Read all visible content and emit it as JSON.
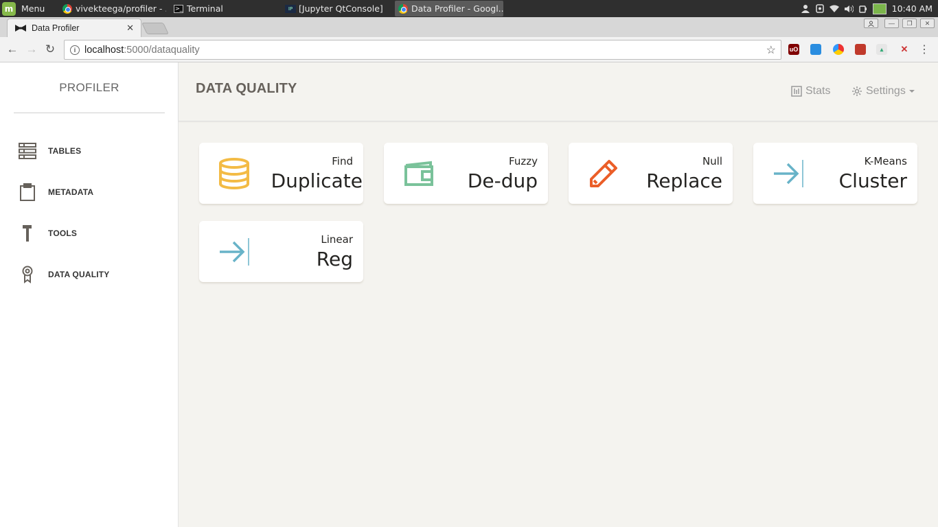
{
  "taskbar": {
    "menu_label": "Menu",
    "tasks": [
      {
        "label": "vivekteega/profiler - ...",
        "icon": "chrome-icon"
      },
      {
        "label": "Terminal",
        "icon": "terminal-icon"
      },
      {
        "label": "[Jupyter QtConsole]",
        "icon": "ipython-icon"
      },
      {
        "label": "Data Profiler - Googl...",
        "icon": "chrome-icon"
      }
    ],
    "clock": "10:40 AM"
  },
  "browser": {
    "tab_title": "Data Profiler",
    "url_host": "localhost",
    "url_path": ":5000/dataquality"
  },
  "sidebar": {
    "brand": "PROFILER",
    "items": [
      {
        "label": "TABLES",
        "icon": "table-list-icon"
      },
      {
        "label": "METADATA",
        "icon": "clipboard-icon"
      },
      {
        "label": "TOOLS",
        "icon": "hammer-icon"
      },
      {
        "label": "DATA QUALITY",
        "icon": "award-ribbon-icon"
      }
    ]
  },
  "header": {
    "title": "DATA QUALITY",
    "stats_label": "Stats",
    "settings_label": "Settings"
  },
  "cards": [
    {
      "small": "Find",
      "big": "Duplicate",
      "icon": "database-icon",
      "color": "#f3bb45"
    },
    {
      "small": "Fuzzy",
      "big": "De-dup",
      "icon": "wallet-icon",
      "color": "#7ac29a"
    },
    {
      "small": "Null",
      "big": "Replace",
      "icon": "pencil-icon",
      "color": "#eb5e28"
    },
    {
      "small": "K-Means",
      "big": "Cluster",
      "icon": "arrow-right-icon",
      "color": "#68b3c8"
    },
    {
      "small": "Linear",
      "big": "Reg",
      "icon": "arrow-right-icon",
      "color": "#68b3c8"
    }
  ]
}
